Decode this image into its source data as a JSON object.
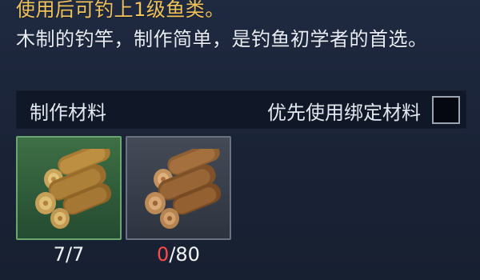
{
  "item": {
    "effect_text": "使用后可钓上1级鱼类。",
    "description": "木制的钓竿，制作简单，是钓鱼初学者的首选。"
  },
  "materials": {
    "title": "制作材料",
    "bound_label": "优先使用绑定材料",
    "bound_checked": false,
    "slots": [
      {
        "icon": "log-bundle-icon",
        "current": "7",
        "separator": "/",
        "required": "7",
        "state": "sufficient",
        "colors": {
          "frame": "#69a76e",
          "count": "#f2f5f8"
        }
      },
      {
        "icon": "log-bundle-icon",
        "current": "0",
        "separator": "/",
        "required": "80",
        "state": "insufficient",
        "colors": {
          "frame": "#6a7280",
          "count_missing": "#ff4a4a",
          "count": "#f2f5f8"
        }
      }
    ]
  },
  "colors": {
    "highlight": "#f0c45b",
    "panel_background": "#1b2437",
    "header_background": "#101726"
  }
}
